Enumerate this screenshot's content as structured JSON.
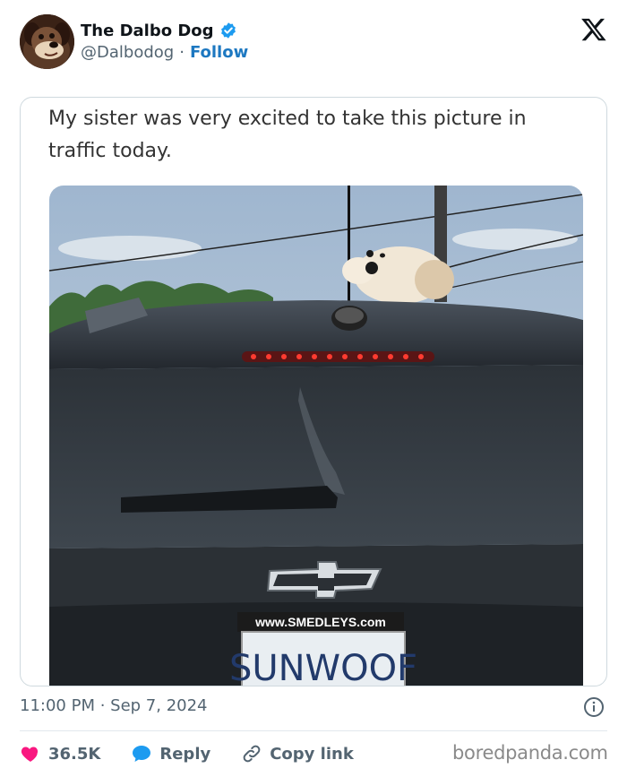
{
  "author": {
    "name": "The Dalbo Dog",
    "handle": "@Dalbodog",
    "separator": "·",
    "follow_label": "Follow"
  },
  "quoted_post": {
    "text": "My sister was very excited to take this picture in traffic today.",
    "photo": {
      "banner_text": "www.SMEDLEYS.com",
      "plate_text": "SUNWOOF"
    }
  },
  "meta": {
    "timestamp": "11:00 PM · Sep 7, 2024"
  },
  "actions": {
    "like_count": "36.5K",
    "reply_label": "Reply",
    "copy_link_label": "Copy link"
  },
  "watermark": "boredpanda.com",
  "colors": {
    "verified": "#1d9bf0",
    "follow": "#1d78c1",
    "like": "#f91880",
    "reply": "#1d9bf0",
    "muted": "#536471"
  },
  "icons": [
    "avatar-dog",
    "verified-badge-icon",
    "x-logo-icon",
    "info-icon",
    "heart-icon",
    "reply-bubble-icon",
    "link-icon"
  ]
}
